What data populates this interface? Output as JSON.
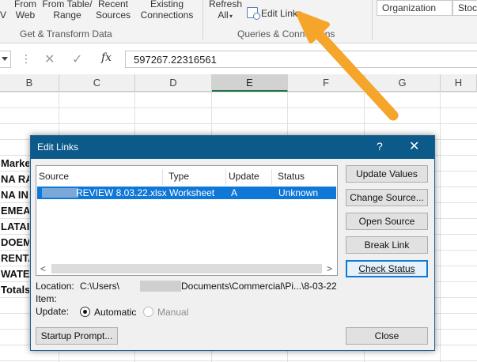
{
  "ribbon": {
    "btn_v": "V",
    "from_web": {
      "line1": "From",
      "line2": "Web"
    },
    "from_table": {
      "line1": "From Table/",
      "line2": "Range"
    },
    "recent_sources": {
      "line1": "Recent",
      "line2": "Sources"
    },
    "existing_connections": {
      "line1": "Existing",
      "line2": "Connections"
    },
    "refresh_all": {
      "line1": "Refresh",
      "line2": "All"
    },
    "edit_links": "Edit Links",
    "get_transform_label": "Get & Transform Data",
    "queries_label": "Queries & Connections",
    "data_type_org": "Organization",
    "data_type_stock": "Stoc"
  },
  "formula_bar": {
    "value": "597267.22316561",
    "fx": "fx"
  },
  "columns": [
    "B",
    "C",
    "D",
    "E",
    "F",
    "G",
    "H"
  ],
  "selected_column": "E",
  "cells_b": [
    "Marke",
    "NA RA",
    "NA IN",
    "EMEA",
    "LATAI",
    "DOEM",
    "RENTA",
    "WATE",
    "Totals"
  ],
  "dialog": {
    "title": "Edit Links",
    "help": "?",
    "close_glyph": "✕",
    "headers": {
      "source": "Source",
      "type": "Type",
      "update": "Update",
      "status": "Status"
    },
    "link_row": {
      "source": "REVIEW 8.03.22.xlsx",
      "type": "Worksheet",
      "update": "A",
      "status": "Unknown"
    },
    "buttons": {
      "update_values": "Update Values",
      "change_source": "Change Source...",
      "open_source": "Open Source",
      "break_link": "Break Link",
      "check_status": "Check Status",
      "startup_prompt": "Startup Prompt...",
      "close": "Close"
    },
    "location_label": "Location:",
    "location_prefix": "C:\\Users\\",
    "location_suffix": "Documents\\Commercial\\Pi...\\8-03-22",
    "item_label": "Item:",
    "update_label": "Update:",
    "update_automatic": "Automatic",
    "update_manual": "Manual"
  },
  "colors": {
    "dialog_title_bg": "#0c5a8a",
    "selection_blue": "#0f78d7",
    "excel_green": "#217346",
    "arrow_orange": "#f4a52a"
  }
}
